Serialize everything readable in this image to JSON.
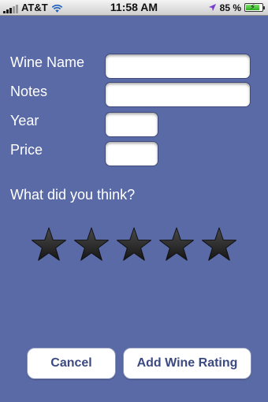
{
  "status_bar": {
    "carrier": "AT&T",
    "time": "11:58 AM",
    "battery_percent": "85 %",
    "battery_level": 0.85,
    "icons": [
      "signal-bars-icon",
      "wifi-icon",
      "location-arrow-icon",
      "battery-charging-icon"
    ]
  },
  "form": {
    "wine_name": {
      "label": "Wine Name",
      "value": ""
    },
    "notes": {
      "label": "Notes",
      "value": ""
    },
    "year": {
      "label": "Year",
      "value": ""
    },
    "price": {
      "label": "Price",
      "value": ""
    }
  },
  "rating": {
    "question": "What did you think?",
    "max_stars": 5,
    "selected_stars": 0
  },
  "actions": {
    "cancel_label": "Cancel",
    "add_label": "Add Wine Rating"
  },
  "colors": {
    "background": "#5a6aa6",
    "button_text": "#3c4a82",
    "star": "#2a2a2a"
  }
}
